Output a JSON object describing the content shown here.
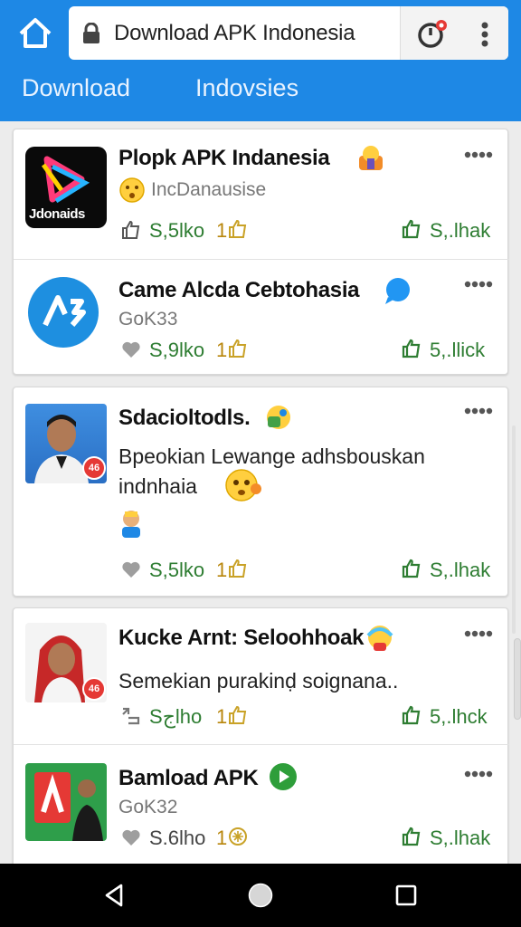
{
  "browser": {
    "url_text": "Download APK Indonesia",
    "icons": [
      "home-icon",
      "lock-icon",
      "timer-icon",
      "more-vert-icon"
    ]
  },
  "tabs": [
    "Download",
    "Indovsies"
  ],
  "colors": {
    "header_blue": "#1e88e5",
    "stat_green": "#2e7d32",
    "count_gold": "#b8860b"
  },
  "posts": [
    {
      "title": "Plopk APK Indanesia",
      "subtitle": "IncDanausise",
      "thumb_label": "Jdonaids",
      "left_count": "S,5lko",
      "mid_count": "1",
      "right_count": "S,.lhak"
    },
    {
      "title": "Came Alcda Cebtohasia",
      "subtitle": "GoK33",
      "left_count": "S,9lko",
      "mid_count": "1",
      "right_count": "5,.llick"
    },
    {
      "title": "Sdacioltodls.",
      "body": "Bpeokian Lewange adhsbouskan indnhaia",
      "badge": "46",
      "left_count": "S,5lko",
      "mid_count": "1",
      "right_count": "S,.lhak"
    },
    {
      "title": "Kucke Arnt: Seloohhoak",
      "body": "Semekian purakinḍ soignana..",
      "badge": "46",
      "left_count": "Sجlho",
      "mid_count": "1",
      "right_count": "5,.lhck"
    },
    {
      "title": "Bamload APK",
      "subtitle": "GoK32",
      "left_count": "S.6lho",
      "mid_count": "1",
      "right_count": "S,.lhak"
    }
  ],
  "navigation": [
    "back-nav",
    "home-nav",
    "recents-nav"
  ]
}
